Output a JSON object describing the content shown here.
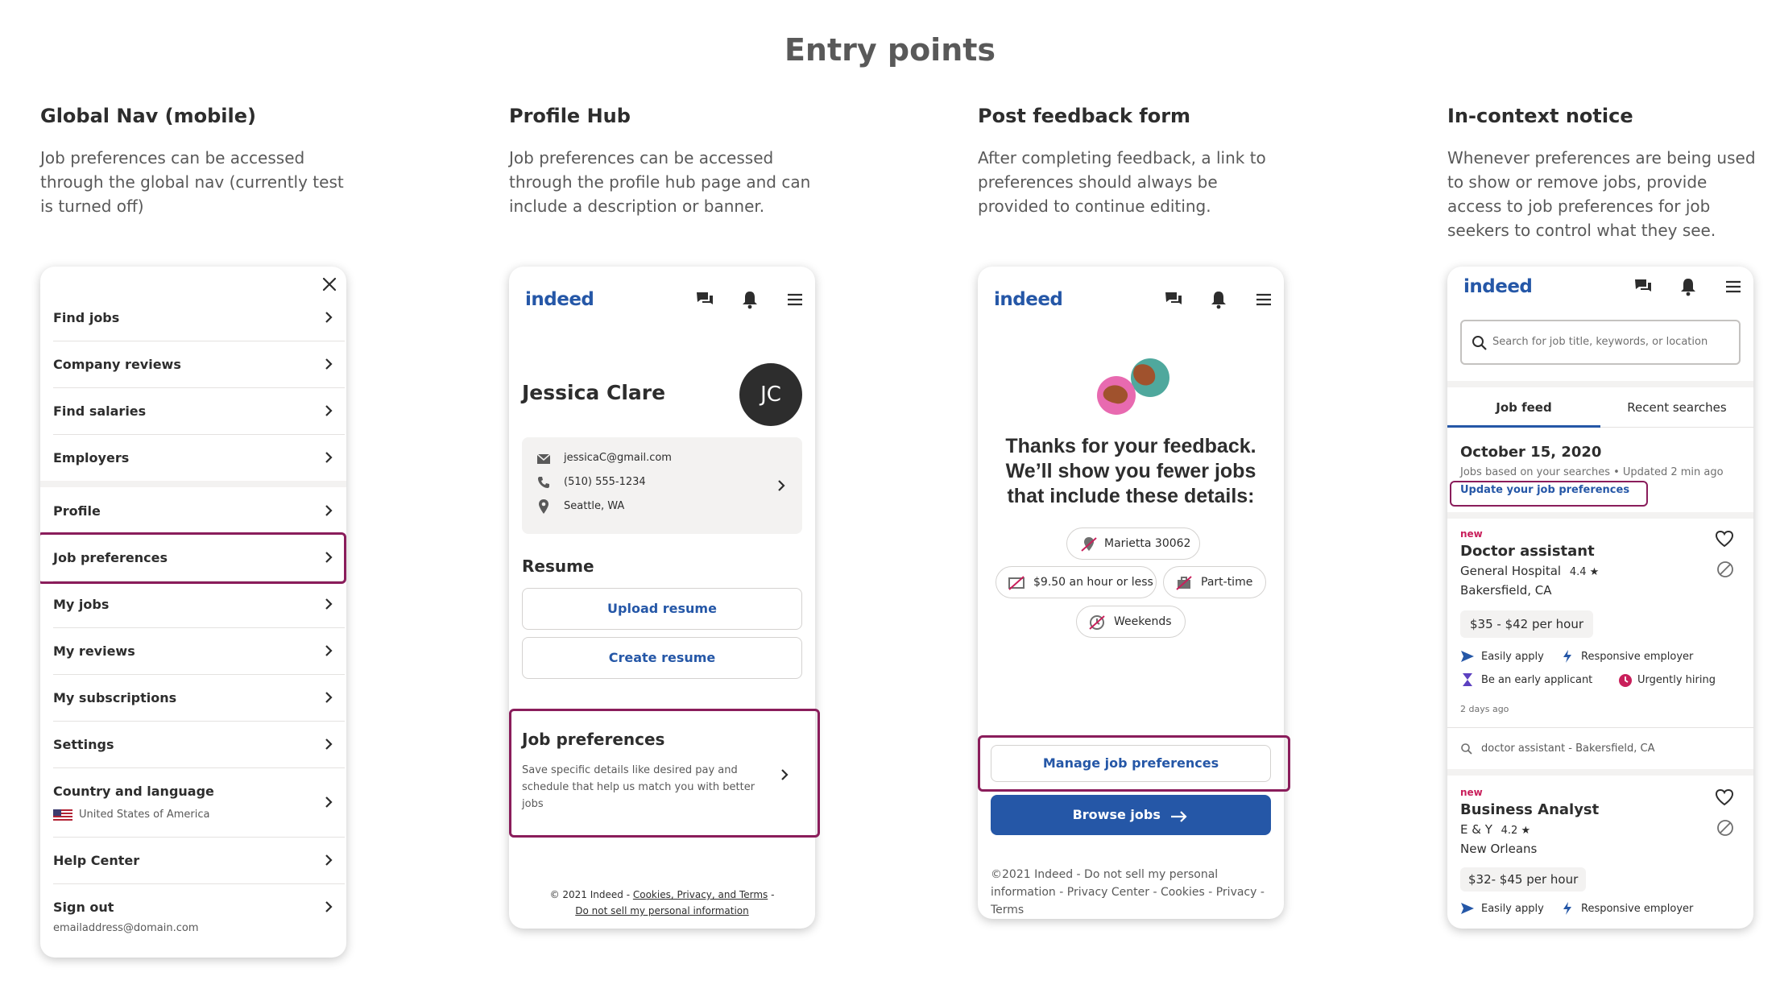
{
  "page_title": "Entry points",
  "columns": [
    {
      "title": "Global Nav (mobile)",
      "description": "Job preferences can be accessed through the global nav (currently test is turned off)"
    },
    {
      "title": "Profile Hub",
      "description": "Job preferences can be accessed through the profile hub page and can include a description or banner."
    },
    {
      "title": "Post feedback form",
      "description": "After completing feedback, a link to preferences should always be provided to continue editing."
    },
    {
      "title": "In-context notice",
      "description": "Whenever preferences are being used to show or remove jobs, provide access to job preferences for job seekers to control what they see."
    }
  ],
  "nav_menu": {
    "items": [
      {
        "label": "Find jobs"
      },
      {
        "label": "Company reviews"
      },
      {
        "label": "Find salaries"
      },
      {
        "label": "Employers"
      },
      {
        "label": "Profile"
      },
      {
        "label": "Job preferences"
      },
      {
        "label": "My jobs"
      },
      {
        "label": "My reviews"
      },
      {
        "label": "My subscriptions"
      },
      {
        "label": "Settings"
      },
      {
        "label": "Country and language",
        "sub": "United States of America"
      },
      {
        "label": "Help Center"
      },
      {
        "label": "Sign out",
        "sub": "emailaddress@domain.com"
      }
    ]
  },
  "brand": {
    "logo": "indeed",
    "color": "#2557a7",
    "highlight": "#8a1d5b"
  },
  "profile_hub": {
    "name": "Jessica Clare",
    "initials": "JC",
    "email": "jessicaC@gmail.com",
    "phone": "(510) 555-1234",
    "location": "Seattle, WA",
    "resume_heading": "Resume",
    "upload_resume": "Upload resume",
    "create_resume": "Create resume",
    "prefs_title": "Job preferences",
    "prefs_desc": "Save specific details like desired pay and schedule that help us match you with better jobs",
    "footer_line1_prefix": "© 2021 Indeed - ",
    "footer_link1": "Cookies, Privacy, and Terms",
    "footer_line1_suffix": " -",
    "footer_link2": "Do not sell my personal information"
  },
  "feedback": {
    "thanks": "Thanks for your feedback. We’ll show you fewer jobs that include these details:",
    "chips": [
      "Marietta 30062",
      "$9.50 an hour or less",
      "Part-time",
      "Weekends"
    ],
    "manage_button": "Manage job preferences",
    "browse_button": "Browse jobs",
    "footer": "©2021 Indeed - Do not sell my personal information - Privacy Center - Cookies - Privacy - Terms"
  },
  "incontext": {
    "search_placeholder": "Search for job title, keywords, or location",
    "tabs": [
      "Job feed",
      "Recent searches"
    ],
    "date": "October 15, 2020",
    "subtitle": "Jobs based on your searches • Updated 2 min ago",
    "update_link": "Update your job preferences",
    "jobs": [
      {
        "badge": "new",
        "title": "Doctor assistant",
        "company": "General Hospital",
        "rating": "4.4 ★",
        "location": "Bakersfield, CA",
        "pay": "$35 - $42 per hour",
        "tags": [
          "Easily apply",
          "Responsive employer",
          "Be an early applicant",
          "Urgently hiring"
        ],
        "age": "2 days ago",
        "search": "doctor assistant - Bakersfield, CA"
      },
      {
        "badge": "new",
        "title": "Business Analyst",
        "company": "E & Y",
        "rating": "4.2 ★",
        "location": "New Orleans",
        "pay": "$32- $45 per hour",
        "tags": [
          "Easily apply",
          "Responsive employer"
        ]
      }
    ]
  }
}
